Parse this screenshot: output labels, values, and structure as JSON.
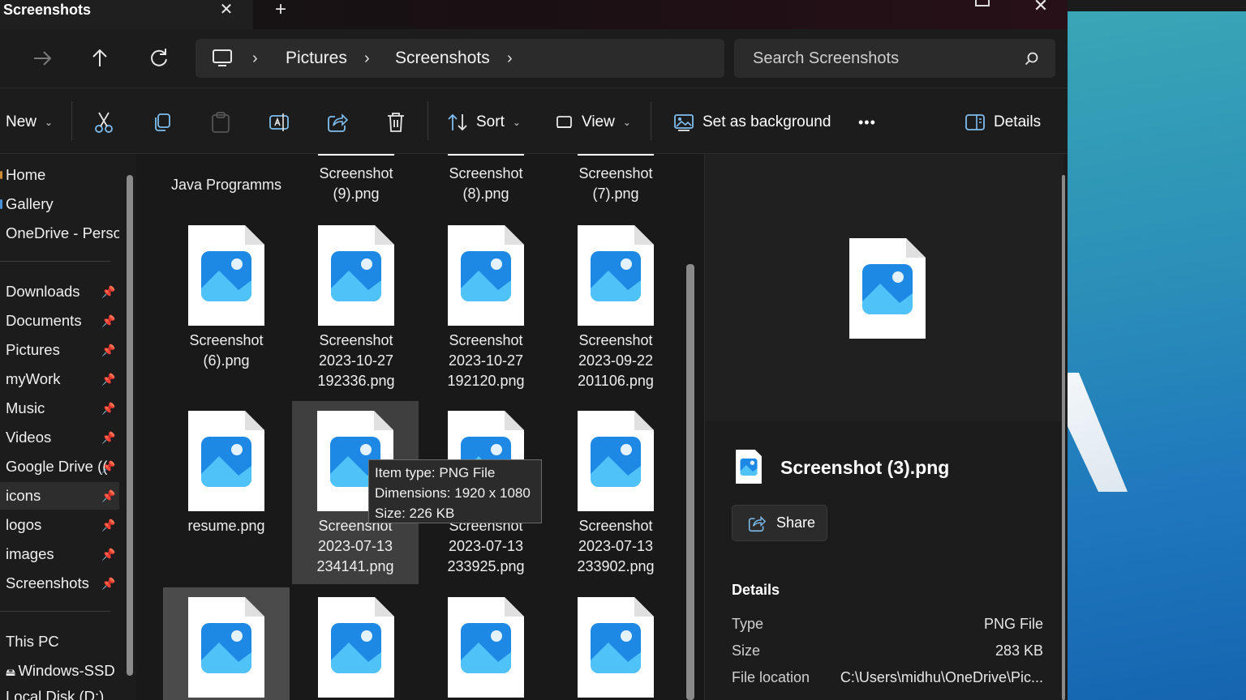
{
  "window": {
    "tab_title": "Screenshots",
    "tab_close": "✕",
    "new_tab": "+"
  },
  "address": {
    "crumbs": [
      "Pictures",
      "Screenshots"
    ],
    "search_placeholder": "Search Screenshots"
  },
  "toolbar": {
    "new_label": "New",
    "sort_label": "Sort",
    "view_label": "View",
    "set_bg_label": "Set as background",
    "more_label": "•••",
    "details_label": "Details"
  },
  "sidebar": {
    "top_items": [
      {
        "label": "Home"
      },
      {
        "label": "Gallery"
      },
      {
        "label": "OneDrive - Persor"
      }
    ],
    "pinned_items": [
      {
        "label": "Downloads"
      },
      {
        "label": "Documents"
      },
      {
        "label": "Pictures"
      },
      {
        "label": "myWork"
      },
      {
        "label": "Music"
      },
      {
        "label": "Videos"
      },
      {
        "label": "Google Drive (("
      },
      {
        "label": "icons"
      },
      {
        "label": "logos"
      },
      {
        "label": "images"
      },
      {
        "label": "Screenshots"
      }
    ],
    "bottom_items": [
      {
        "label": "This PC"
      },
      {
        "label": "Windows-SSD (("
      },
      {
        "label": "Local Disk (D:)"
      }
    ]
  },
  "files": {
    "row0": [
      "Java Programms",
      "Screenshot\n(9).png",
      "Screenshot\n(8).png",
      "Screenshot\n(7).png"
    ],
    "row1": [
      "Screenshot\n(6).png",
      "Screenshot\n2023-10-27\n192336.png",
      "Screenshot\n2023-10-27\n192120.png",
      "Screenshot\n2023-09-22\n201106.png"
    ],
    "row2": [
      "resume.png",
      "Screenshot\n2023-07-13\n234141.png",
      "Screenshot\n2023-07-13\n233925.png",
      "Screenshot\n2023-07-13\n233902.png"
    ]
  },
  "tooltip": {
    "type": "Item type: PNG File",
    "dimensions": "Dimensions: 1920 x 1080",
    "size": "Size: 226 KB"
  },
  "details": {
    "file_name": "Screenshot (3).png",
    "share_label": "Share",
    "heading": "Details",
    "properties": [
      {
        "key": "Type",
        "value": "PNG File"
      },
      {
        "key": "Size",
        "value": "283 KB"
      },
      {
        "key": "File location",
        "value": "C:\\Users\\midhu\\OneDrive\\Pic..."
      }
    ]
  },
  "colors": {
    "accent": "#4a90d9",
    "image_icon_blue": "#2196f3",
    "window_bg": "#191919"
  }
}
